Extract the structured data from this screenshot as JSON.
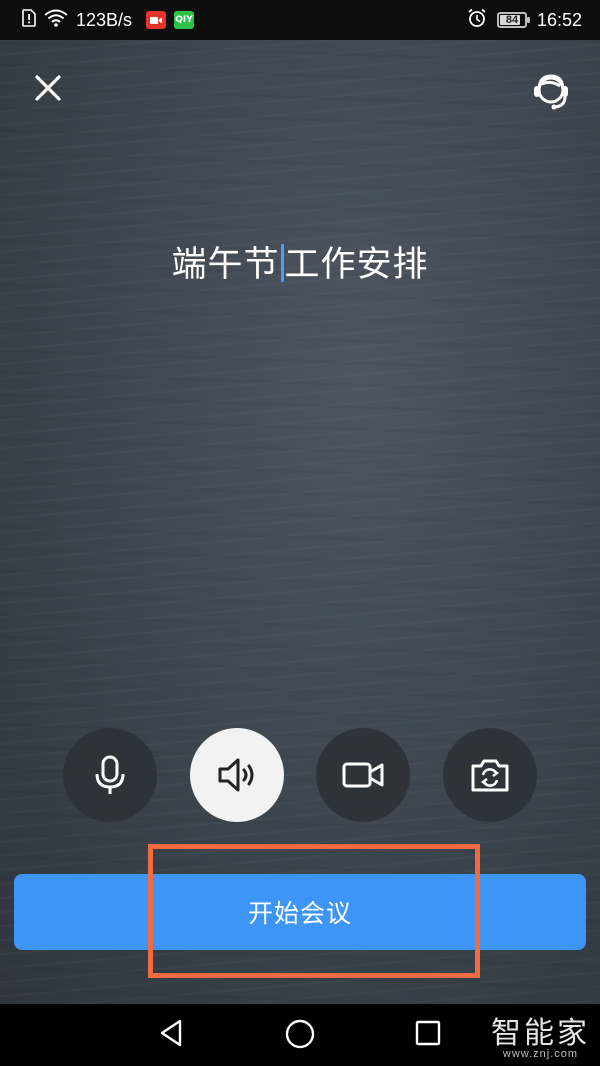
{
  "status_bar": {
    "net_speed": "123B/s",
    "battery": "84",
    "battery_level": 0.84,
    "time": "16:52",
    "icons": [
      "sim-alert-icon",
      "wifi-icon",
      "video-app-icon",
      "iqiyi-app-icon",
      "alarm-icon",
      "battery-icon"
    ],
    "iqiyi_text": "QIY"
  },
  "header": {
    "close_icon": "close-icon",
    "support_icon": "customer-service-icon"
  },
  "meeting": {
    "title_before_cursor": "端午节",
    "title_after_cursor": "工作安排"
  },
  "controls": [
    {
      "name": "microphone-button",
      "icon": "microphone-icon",
      "active": false
    },
    {
      "name": "speaker-button",
      "icon": "speaker-icon",
      "active": true
    },
    {
      "name": "camera-button",
      "icon": "video-camera-icon",
      "active": false
    },
    {
      "name": "switch-camera-button",
      "icon": "switch-camera-icon",
      "active": false
    }
  ],
  "start_button": {
    "label": "开始会议"
  },
  "colors": {
    "accent": "#3d95f7",
    "highlight": "#f26a3f",
    "cursor": "#4a9bff"
  },
  "navbar": {
    "icons": [
      "back-icon",
      "home-icon",
      "recent-apps-icon"
    ]
  },
  "watermark": {
    "logo": "智能家",
    "url": "www.znj.com"
  }
}
